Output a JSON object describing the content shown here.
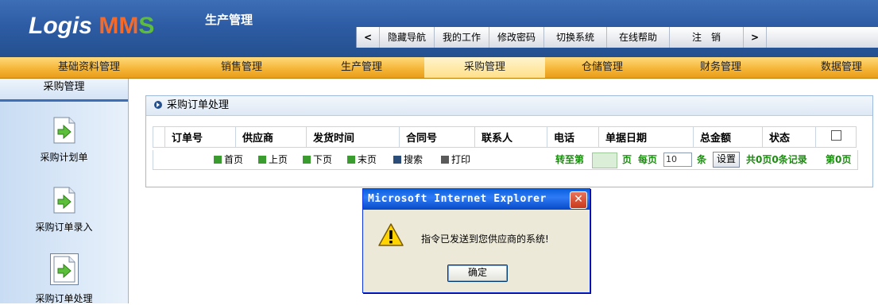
{
  "header": {
    "logo": {
      "part1": "Logis ",
      "m1": "M",
      "m2": "M",
      "s": "S"
    },
    "module_title": "生产管理",
    "topnav": {
      "prev": "<",
      "items": [
        "隐藏导航",
        "我的工作",
        "修改密码",
        "切换系统",
        "在线帮助",
        "注　销"
      ],
      "next": ">"
    }
  },
  "mainbar": {
    "tabs": [
      "基础资料管理",
      "销售管理",
      "生产管理",
      "采购管理",
      "仓储管理",
      "财务管理",
      "数据管理"
    ],
    "active": "采购管理"
  },
  "sidebar": {
    "title": "采购管理",
    "items": [
      "采购计划单",
      "采购订单录入",
      "采购订单处理"
    ],
    "selected": "采购订单处理"
  },
  "panel": {
    "title": "采购订单处理",
    "columns": [
      "订单号",
      "供应商",
      "发货时间",
      "合同号",
      "联系人",
      "电话",
      "单据日期",
      "总金额",
      "状态"
    ],
    "pager": {
      "first": "首页",
      "prev": "上页",
      "next": "下页",
      "last": "末页",
      "search": "搜索",
      "print": "打印",
      "goto": "转至第",
      "page_unit": "页",
      "per_page": "每页",
      "page_size": "10",
      "rows_unit": "条",
      "set_btn": "设置",
      "summary": "共0页0条记录",
      "current": "第0页"
    }
  },
  "dialog": {
    "title": "Microsoft Internet Explorer",
    "message": "指令已发送到您供应商的系统!",
    "ok": "确定"
  },
  "colors": {
    "header_blue": "#2e5ca4",
    "tab_orange": "#f4b334",
    "pager_green": "#1b8c0f",
    "logo_orange": "#f36a2a",
    "logo_green": "#5dbb3e"
  }
}
